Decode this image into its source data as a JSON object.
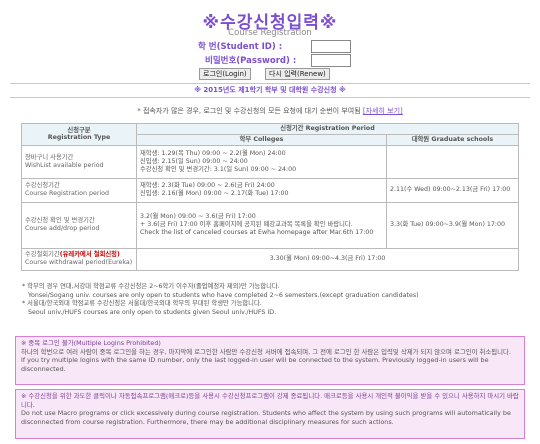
{
  "header": {
    "title": "※수강신청입력※",
    "subtitle": "Course Registration"
  },
  "login": {
    "student_id_label": "학     번(Student ID) :",
    "password_label": "비밀번호(Password) :",
    "login_button": "로그인(Login)",
    "renew_button": "다시 입력(Renew)"
  },
  "notice": "※ 2015년도 제1학기 학부 및 대학원 수강신청 ※",
  "info": {
    "text": "* 접속자가 많은 경우, 로그인 및 수강신청의 모든 요청에 대기 순번이 부여됨",
    "link": "[자세히 보기]"
  },
  "table": {
    "head_type": "신청구분",
    "head_type_en": "Registration Type",
    "head_period": "신청기간 Registration Period",
    "head_undergrad": "학부 Colleges",
    "head_grad": "대학원 Graduate schools",
    "rows": [
      {
        "type": "장바구니 사용기간",
        "type_en": "WishList available period",
        "undergrad": [
          "재학생: 1.29(목 Thu) 09:00 ~ 2.2(월 Mon) 24:00",
          "신입생: 2.15(일 Sun) 09:00 ~ 24:00",
          "수강신청 확인 및 변경기간: 3.1(일 Sun) 09:00 ~ 24:00"
        ],
        "grad": ""
      },
      {
        "type": "수강신청기간",
        "type_en": "Course Registration period",
        "undergrad": [
          "재학생: 2.3(화 Tue) 09:00 ~ 2.6(금 Fri) 24:00",
          "신입생: 2.16(월 Mon) 09:00 ~ 2.17(화 Tue) 17:00"
        ],
        "grad": "2.11(수 Wed) 09:00~2.13(금 Fri) 17:00"
      },
      {
        "type": "수강신청 확인 및 변경기간",
        "type_en": "Course add/drop period",
        "undergrad": [
          "3.2(월 Mon) 09:00 ~ 3.6(금 Fri) 17:00",
          "+ 3.6(금 Fri) 17:00 이후 홈페이지에 공지된 폐강교과목 목록을 확인 바랍니다.",
          "Check the list of canceled courses at Ewha homepage after Mar.6th 17:00"
        ],
        "grad": "3.3(화 Tue) 09:00~3.9(월 Mon) 17:00"
      },
      {
        "type_prefix": "수강철회기간",
        "type_red": "(유레카에서 철회신청)",
        "type_en": "Course withdrawal period(Eureka)",
        "merged": "3.30(월 Mon) 09:00~4.3(금 Fri) 17:00"
      }
    ]
  },
  "notes": [
    "* 학부의 경우 연대,서강대 학점교류 수강신청은 2~6학기 이수자(졸업예정자 제외)만 가능합니다.",
    "Yonsei/Sogang univ. courses are only open to students who have completed 2~6 semesters.(except graduation candidates)",
    "* 서울대/한국외대 학점교류 수강신청은 서울대/한국외대 학부의 부대된 학생만 가능합니다.",
    "Seoul univ./HUFS courses are only open to students given Seoul univ./HUFS ID."
  ],
  "box1": {
    "head": "※ 중복 로그인 불가(Multiple Logins Prohibited)",
    "lines": [
      "하나의 학번으로 여러 사람이 중복 로그인을 하는 경우, 마지막에 로그인한 사람만 수강신청 서버에 접속되며, 그 전에 로그인 한 사람은 입력및 삭제가 되지 않으며 로그인이 취소됩니다.",
      "If you try multiple logins with the same ID number, only the last logged-in user will be connected to the system. Previously logged-in users will be disconnected."
    ]
  },
  "box2": {
    "lines": [
      "※ 수강신청을 위한 과도한 클릭이나 자동접속프로그램(매크로)등을 사용시 수강신청프로그램이 강제 종료됩니다. 매크로등을 사용시 개인적 불이익을 받을 수 있으니 사용하지 마시기 바랍니다.",
      "Do not use Macro programs or click excessively during course registration. Students who affect the system by using such programs will automatically be disconnected from course registration. Furthermore, there may be additional disciplinary measures for such actions."
    ]
  }
}
